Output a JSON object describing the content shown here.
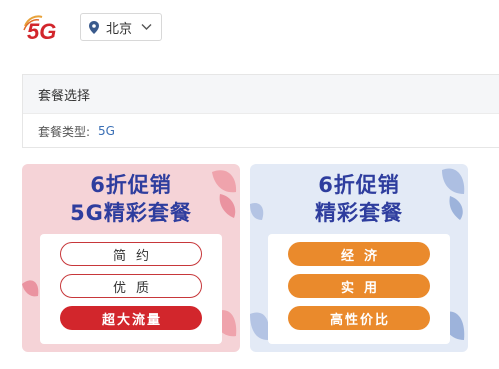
{
  "header": {
    "logo_text": "5G",
    "city": "北京",
    "icons": {
      "location": "map-pin-icon",
      "dropdown": "chevron-down-icon"
    }
  },
  "package_panel": {
    "title": "套餐选择",
    "type_label": "套餐类型:",
    "type_value": "5G"
  },
  "cards": [
    {
      "title_line1": "6折促销",
      "title_line2": "5G精彩套餐",
      "options": [
        "简约",
        "优质",
        "超大流量"
      ],
      "colors": {
        "bg": "#f5d3d7",
        "accent": "#d2262c"
      }
    },
    {
      "title_line1": "6折促销",
      "title_line2": "精彩套餐",
      "options": [
        "经济",
        "实用",
        "高性价比"
      ],
      "colors": {
        "bg": "#e3eaf6",
        "accent": "#ea8a2c"
      }
    }
  ],
  "colors": {
    "title_blue": "#2e3d9e",
    "link_blue": "#3a6fb5",
    "brand_red": "#d2262c"
  }
}
